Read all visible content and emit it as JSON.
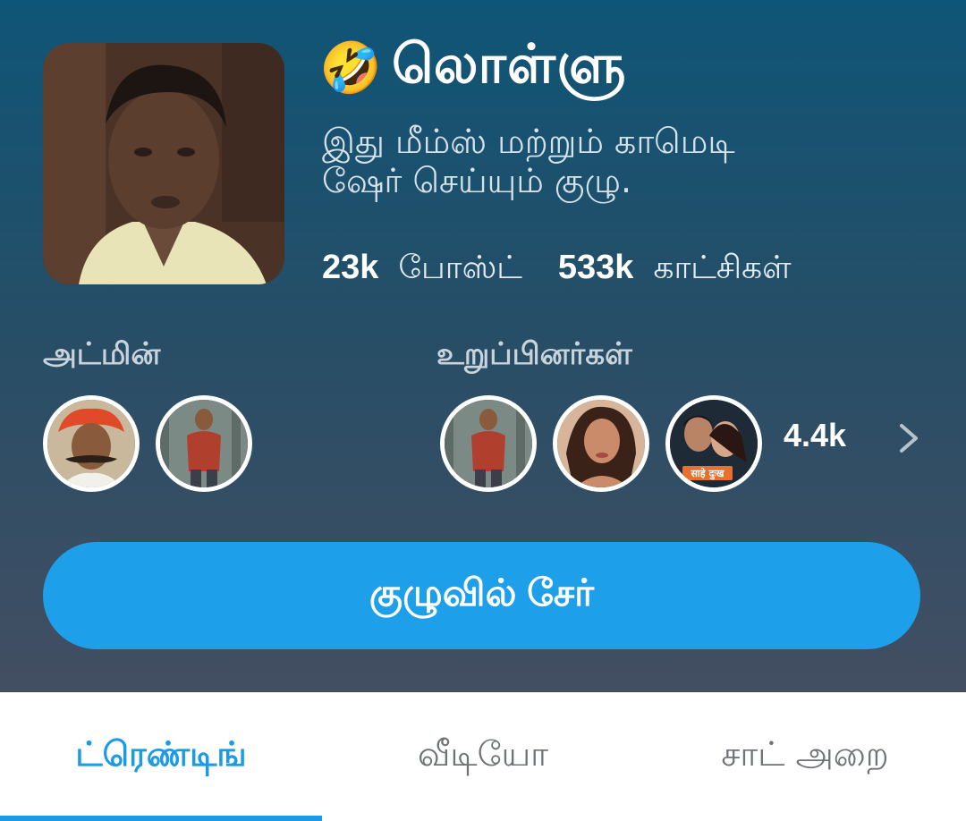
{
  "group": {
    "emoji": "🤣",
    "title": "லொள்ளு",
    "description_line1": "இது மீம்ஸ் மற்றும் காமெடி",
    "description_line2": "ஷேர் செய்யும் குழு.",
    "posts_count": "23k",
    "posts_label": "போஸ்ட்",
    "views_count": "533k",
    "views_label": "காட்சிகள்"
  },
  "admins": {
    "label": "அட்மின்",
    "avatars": [
      "admin-avatar-1",
      "admin-avatar-2"
    ]
  },
  "members": {
    "label": "உறுப்பினர்கள்",
    "count": "4.4k",
    "avatars": [
      "member-avatar-1",
      "member-avatar-2",
      "member-avatar-3"
    ],
    "poster_text": "साहे दुःख"
  },
  "join_button": {
    "label": "குழுவில் சேர்"
  },
  "tabs": [
    {
      "label": "ட்ரெண்டிங்",
      "active": true
    },
    {
      "label": "வீடியோ",
      "active": false
    },
    {
      "label": "சாட் அறை",
      "active": false
    }
  ],
  "colors": {
    "accent": "#1b9be6",
    "header_top": "#0f5577",
    "header_bottom": "#434e62"
  }
}
